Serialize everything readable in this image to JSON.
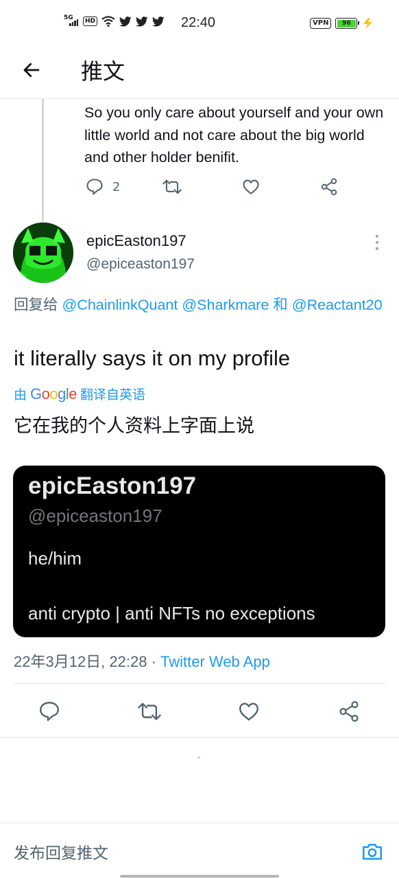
{
  "status_bar": {
    "network": "5G",
    "hd": "HD",
    "time": "22:40",
    "vpn": "VPN",
    "battery": "96",
    "battery_color": "#4cd137"
  },
  "header": {
    "title": "推文",
    "back_icon": "arrow-left-icon"
  },
  "previous_tweet": {
    "text": "So you only care about yourself and your own little world and not care about the big world and other holder benifit.",
    "reply_count": "2"
  },
  "tweet": {
    "author_name": "epicEaston197",
    "author_handle": "@epiceaston197",
    "reply_prefix": "回复给",
    "mention_1": "@ChainlinkQuant",
    "mention_2": "@Sharkmare",
    "reply_and": "和",
    "mention_3": "@Reactant20",
    "text": "it literally says it on my profile",
    "translated_by_prefix": "由",
    "translated_by_brand": "Google",
    "translated_by_suffix": "翻译自英语",
    "translated_text": "它在我的个人资料上字面上说",
    "media": {
      "name": "epicEaston197",
      "handle": "@epiceaston197",
      "pronouns": "he/him",
      "bio": "anti crypto | anti NFTs no exceptions"
    },
    "timestamp": "22年3月12日, 22:28",
    "separator": " · ",
    "source": "Twitter Web App"
  },
  "reply_bar": {
    "placeholder": "发布回复推文"
  },
  "colors": {
    "link": "#1d9bf0",
    "secondary_text": "#536471",
    "primary_text": "#0f1419"
  }
}
